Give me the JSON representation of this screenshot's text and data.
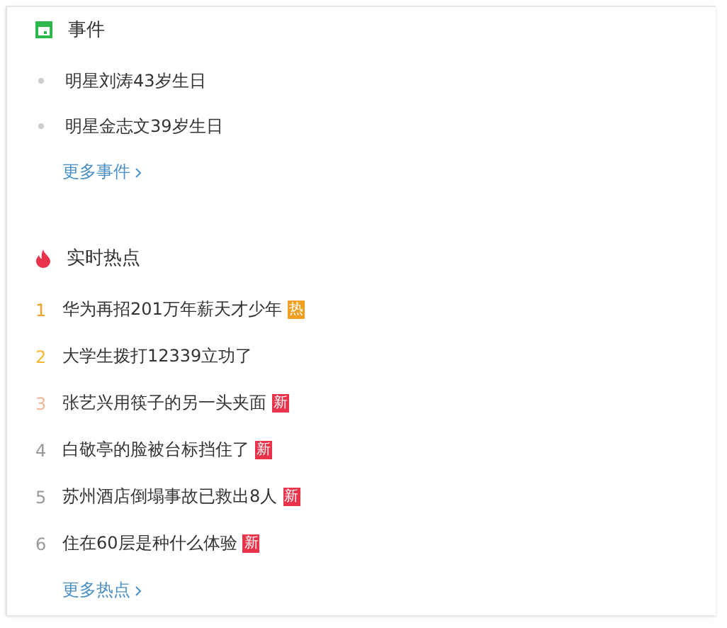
{
  "events": {
    "title": "事件",
    "items": [
      {
        "text": "明星刘涛43岁生日"
      },
      {
        "text": "明星金志文39岁生日"
      }
    ],
    "more": "更多事件"
  },
  "hot": {
    "title": "实时热点",
    "items": [
      {
        "rank": "1",
        "color": "#f0a020",
        "text": "华为再招201万年薪天才少年",
        "badge": {
          "kind": "hot",
          "text": "热"
        }
      },
      {
        "rank": "2",
        "color": "#f5b830",
        "text": "大学生拨打12339立功了"
      },
      {
        "rank": "3",
        "color": "#f0b898",
        "text": "张艺兴用筷子的另一头夹面",
        "badge": {
          "kind": "new",
          "text": "新"
        }
      },
      {
        "rank": "4",
        "color": "#999999",
        "text": "白敬亭的脸被台标挡住了",
        "badge": {
          "kind": "new",
          "text": "新"
        }
      },
      {
        "rank": "5",
        "color": "#999999",
        "text": "苏州酒店倒塌事故已救出8人",
        "badge": {
          "kind": "new",
          "text": "新"
        }
      },
      {
        "rank": "6",
        "color": "#999999",
        "text": "住在60层是种什么体验",
        "badge": {
          "kind": "new",
          "text": "新"
        }
      }
    ],
    "more": "更多热点"
  }
}
